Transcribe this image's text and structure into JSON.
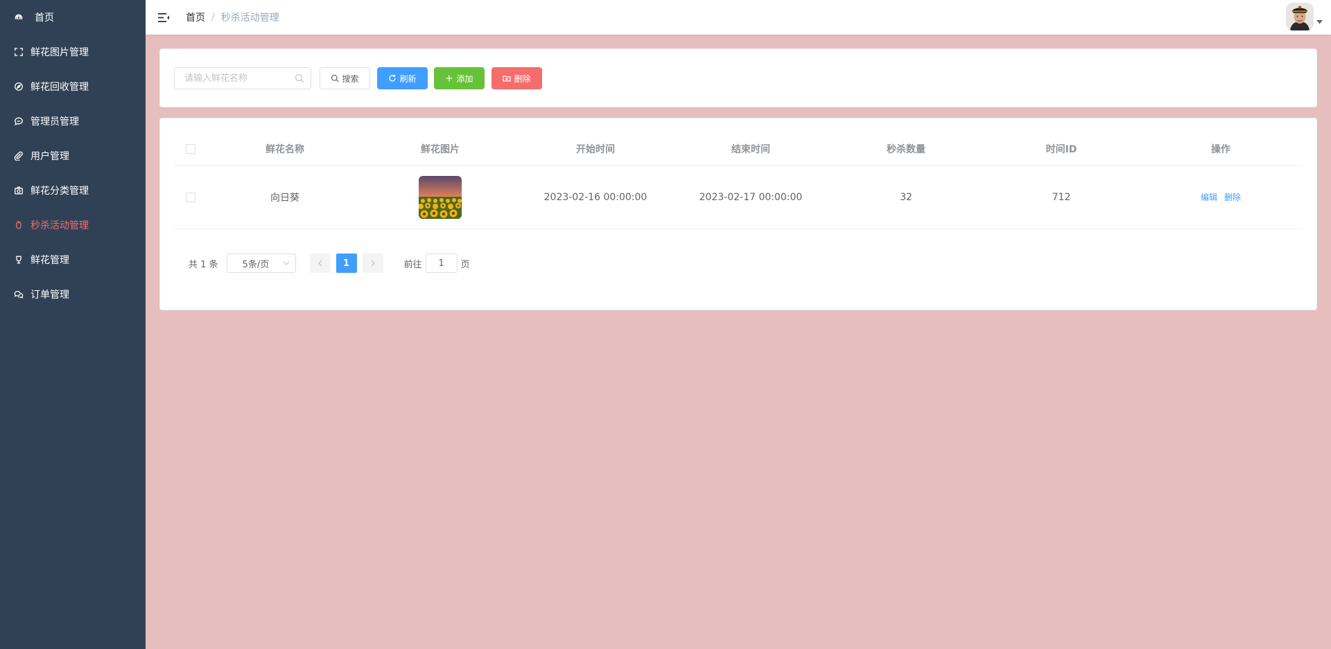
{
  "sidebar": {
    "items": [
      {
        "label": "首页",
        "icon": "dashboard-icon",
        "active": false
      },
      {
        "label": "鲜花图片管理",
        "icon": "fullscreen-icon",
        "active": false
      },
      {
        "label": "鲜花回收管理",
        "icon": "compass-icon",
        "active": false
      },
      {
        "label": "管理员管理",
        "icon": "chat-icon",
        "active": false
      },
      {
        "label": "用户管理",
        "icon": "paperclip-icon",
        "active": false
      },
      {
        "label": "鲜花分类管理",
        "icon": "camera-icon",
        "active": false
      },
      {
        "label": "秒杀活动管理",
        "icon": "mouse-icon",
        "active": true
      },
      {
        "label": "鲜花管理",
        "icon": "trophy-icon",
        "active": false
      },
      {
        "label": "订单管理",
        "icon": "chat-double-icon",
        "active": false
      }
    ]
  },
  "header": {
    "breadcrumb_home": "首页",
    "breadcrumb_sep": "/",
    "breadcrumb_current": "秒杀活动管理"
  },
  "toolbar": {
    "search_placeholder": "请输入鲜花名称",
    "search_label": "搜索",
    "refresh_label": "刷新",
    "add_label": "添加",
    "delete_label": "删除"
  },
  "table": {
    "columns": [
      "鲜花名称",
      "鲜花图片",
      "开始时间",
      "结束时间",
      "秒杀数量",
      "时间ID",
      "操作"
    ],
    "rows": [
      {
        "name": "向日葵",
        "start": "2023-02-16 00:00:00",
        "end": "2023-02-17 00:00:00",
        "quantity": "32",
        "time_id": "712",
        "edit": "编辑",
        "delete": "删除"
      }
    ]
  },
  "pagination": {
    "total_text": "共 1 条",
    "page_size": "5条/页",
    "current_page": "1",
    "goto_label": "前往",
    "goto_value": "1",
    "page_suffix": "页"
  },
  "colors": {
    "sidebar_bg": "#304156",
    "active_menu": "#f56c6c",
    "content_bg": "#e6bebe",
    "primary": "#409eff",
    "success": "#67c23a",
    "danger": "#f56c6c"
  }
}
